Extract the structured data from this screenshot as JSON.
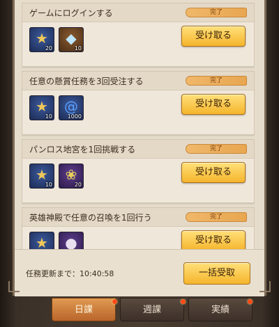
{
  "quests": [
    {
      "title": "ゲームにログインする",
      "status": "完了",
      "claim": "受け取る",
      "rewards": [
        {
          "icon": "star-icon",
          "qty": "20",
          "bg": "blue"
        },
        {
          "icon": "diamond-icon",
          "qty": "10",
          "bg": "brown"
        }
      ]
    },
    {
      "title": "任意の懸賞任務を3回受注する",
      "status": "完了",
      "claim": "受け取る",
      "rewards": [
        {
          "icon": "star-icon",
          "qty": "10",
          "bg": "blue"
        },
        {
          "icon": "spiral-shell-icon",
          "qty": "1000",
          "bg": "blue"
        }
      ]
    },
    {
      "title": "パンロス地宮を1回挑戦する",
      "status": "完了",
      "claim": "受け取る",
      "rewards": [
        {
          "icon": "star-icon",
          "qty": "10",
          "bg": "blue"
        },
        {
          "icon": "seed-icon",
          "qty": "20",
          "bg": "purple"
        }
      ]
    },
    {
      "title": "英雄神殿で任意の召喚を1回行う",
      "status": "完了",
      "claim": "受け取る",
      "rewards": [
        {
          "icon": "star-icon",
          "qty": "",
          "bg": "blue"
        },
        {
          "icon": "item-icon",
          "qty": "",
          "bg": "purple"
        }
      ]
    }
  ],
  "footer": {
    "timer_label": "任務更新まで：10:40:58",
    "bulk_claim": "一括受取"
  },
  "tabs": [
    {
      "label": "日課",
      "active": true
    },
    {
      "label": "週課",
      "active": false
    },
    {
      "label": "実績",
      "active": false
    }
  ]
}
